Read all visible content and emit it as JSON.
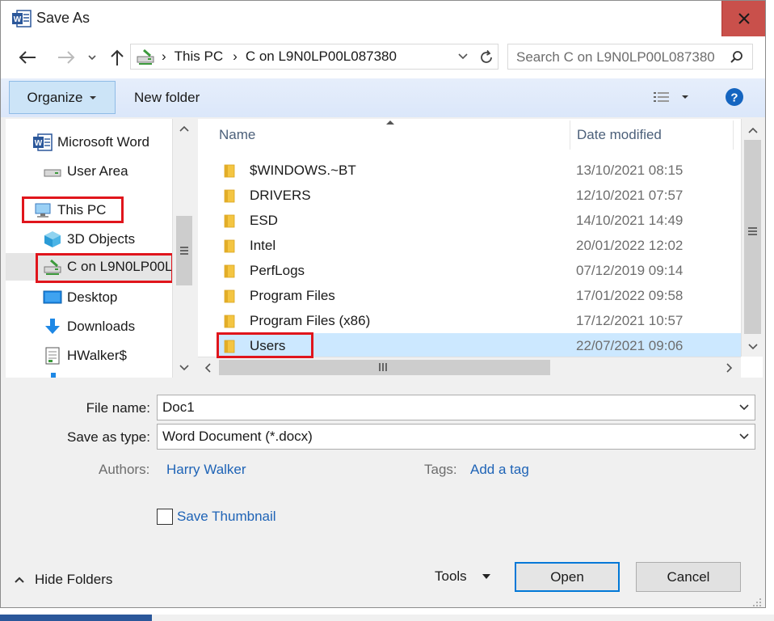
{
  "window": {
    "title": "Save As"
  },
  "nav": {
    "address_parts": [
      "This PC",
      "C on L9N0LP00L087380"
    ],
    "search_placeholder": "Search C on L9N0LP00L087380"
  },
  "toolbar": {
    "organize": "Organize",
    "new_folder": "New folder"
  },
  "sidebar": {
    "items": [
      {
        "label": "Microsoft Word",
        "icon": "word-icon"
      },
      {
        "label": "User Area",
        "icon": "drive-icon"
      },
      {
        "label": "This PC",
        "icon": "computer-icon"
      },
      {
        "label": "3D Objects",
        "icon": "cube-icon"
      },
      {
        "label": "C on L9N0LP00L",
        "icon": "network-drive-icon"
      },
      {
        "label": "Desktop",
        "icon": "desktop-icon"
      },
      {
        "label": "Downloads",
        "icon": "download-icon"
      },
      {
        "label": "HWalker$",
        "icon": "document-icon"
      }
    ]
  },
  "files": {
    "columns": {
      "name": "Name",
      "date": "Date modified"
    },
    "rows": [
      {
        "name": "$WINDOWS.~BT",
        "date": "13/10/2021 08:15"
      },
      {
        "name": "DRIVERS",
        "date": "12/10/2021 07:57"
      },
      {
        "name": "ESD",
        "date": "14/10/2021 14:49"
      },
      {
        "name": "Intel",
        "date": "20/01/2022 12:02"
      },
      {
        "name": "PerfLogs",
        "date": "07/12/2019 09:14"
      },
      {
        "name": "Program Files",
        "date": "17/01/2022 09:58"
      },
      {
        "name": "Program Files (x86)",
        "date": "17/12/2021 10:57"
      },
      {
        "name": "Users",
        "date": "22/07/2021 09:06"
      }
    ]
  },
  "form": {
    "file_name_label": "File name:",
    "file_name_value": "Doc1",
    "type_label": "Save as type:",
    "type_value": "Word Document (*.docx)",
    "authors_label": "Authors:",
    "authors_value": "Harry Walker",
    "tags_label": "Tags:",
    "tags_value": "Add a tag",
    "thumbnail_label": "Save Thumbnail"
  },
  "footer": {
    "hide_folders": "Hide Folders",
    "tools": "Tools",
    "open": "Open",
    "cancel": "Cancel"
  },
  "colors": {
    "accent": "#0078d7",
    "close": "#c9504b",
    "highlight": "#e0151c",
    "selection": "#cce8ff"
  }
}
